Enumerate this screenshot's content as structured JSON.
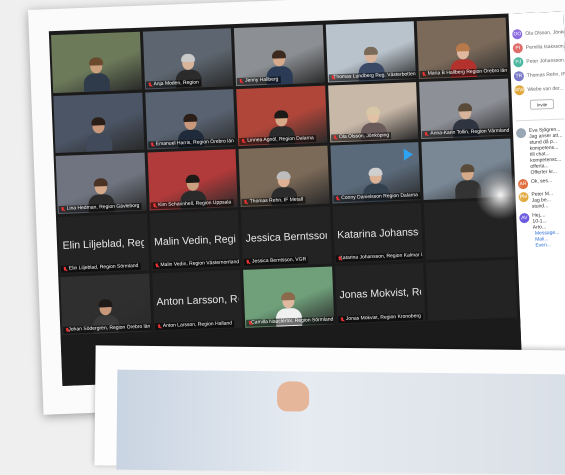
{
  "participants_grid": [
    {
      "name": "",
      "kind": "video",
      "bg": "#6c7a5a",
      "skin": "#caa07f",
      "hair": "#6b4a2e",
      "shirt": "#2f3b4a"
    },
    {
      "name": "Anja Moden, Region",
      "kind": "video",
      "bg": "#5d6670",
      "skin": "#d8b49a",
      "hair": "#c9c9c9",
      "shirt": "#2b2b2b"
    },
    {
      "name": "Jenny Hallberg",
      "kind": "video",
      "bg": "#8c8f93",
      "skin": "#d7a98b",
      "hair": "#3d2a1e",
      "shirt": "#2b3a55"
    },
    {
      "name": "Thomas Lundberg Reg. Västerbotten",
      "kind": "video",
      "bg": "#b9c3cc",
      "skin": "#d9b39a",
      "hair": "#7a6a5a",
      "shirt": "#3a4a66"
    },
    {
      "name": "Maria B Hallberg Region Örebro län",
      "kind": "video",
      "bg": "#7b6a5a",
      "skin": "#e0b8a0",
      "hair": "#b87a4a",
      "shirt": "#b3322e"
    },
    {
      "name": "",
      "kind": "video",
      "bg": "#4b5565",
      "skin": "#c9987a",
      "hair": "#2a1e16",
      "shirt": "#404a5a"
    },
    {
      "name": "Emanuel Harris, Region Örebro län",
      "kind": "video",
      "bg": "#586270",
      "skin": "#c9987a",
      "hair": "#2a1e16",
      "shirt": "#1f2a3a"
    },
    {
      "name": "Linnea Agnöl, Region Dalarna",
      "kind": "video",
      "bg": "#b0463a",
      "skin": "#d6a988",
      "hair": "#1e1a18",
      "shirt": "#2b2b2b"
    },
    {
      "name": "Ola Olsson, Jönköping",
      "kind": "video",
      "bg": "#c8b8a8",
      "skin": "#e2c0a6",
      "hair": "#d8c8a8",
      "shirt": "#6a5a5a"
    },
    {
      "name": "Anna-Karin Tollin, Region Värmland",
      "kind": "video",
      "bg": "#8e9097",
      "skin": "#d8b49a",
      "hair": "#5a4a3a",
      "shirt": "#2e3440"
    },
    {
      "name": "Lina Hedman, Region Gävleborg",
      "kind": "video",
      "bg": "#6f7480",
      "skin": "#d7a98b",
      "hair": "#4a3324",
      "shirt": "#2b2b2b"
    },
    {
      "name": "Kim Scharinhell, Region Uppsala",
      "kind": "video",
      "bg": "#b13a3a",
      "skin": "#caa07f",
      "hair": "#1e1a18",
      "shirt": "#2a2a2a"
    },
    {
      "name": "Thomas Rehn, IF Metall",
      "kind": "video",
      "bg": "#7c6a58",
      "skin": "#deb094",
      "hair": "#bdbdbd",
      "shirt": "#2b2b2b"
    },
    {
      "name": "Conny Danielsson Region Dalarna",
      "kind": "video",
      "bg": "#5b6a7a",
      "skin": "#dcb296",
      "hair": "#cfcfcf",
      "shirt": "#33404e"
    },
    {
      "name": "",
      "kind": "video",
      "bg": "#7a8896",
      "skin": "#d6a988",
      "hair": "#5a4a3a",
      "shirt": "#333"
    },
    {
      "name": "Elin Liljeblad, Region So...",
      "label": "Elin Liljeblad, Region Sörmland",
      "kind": "blank"
    },
    {
      "name": "Malin Vedin, Region Väs...",
      "label": "Malin Vedin, Region Västernorrland",
      "kind": "blank"
    },
    {
      "name": "Jessica Berntsson, VGR",
      "label": "Jessica Berntsson, VGR",
      "kind": "blank"
    },
    {
      "name": "Katarina Johansson, Re...",
      "label": "Katarina Johansson, Region Kalmar l...",
      "kind": "blank"
    },
    {
      "name": "",
      "kind": "blank"
    },
    {
      "name": "Johan Södergren, Region Örebro län",
      "kind": "video",
      "bg": "#2f2f2f",
      "skin": "#c9987a",
      "hair": "#1e1a18",
      "shirt": "#3a3a3a"
    },
    {
      "name": "Anton Larsson, Region...",
      "label": "Anton Larsson, Region Halland",
      "kind": "blank"
    },
    {
      "name": "Camilla Nauclértor, Region Sörmland",
      "kind": "video",
      "bg": "#6fa07a",
      "skin": "#e0b8a0",
      "hair": "#8a6a4a",
      "shirt": "#f0f0f0"
    },
    {
      "name": "Jonas Mokvist, Region...",
      "label": "Jonas Mokvist, Region Kronoberg",
      "kind": "blank"
    },
    {
      "name": "",
      "kind": "blank"
    }
  ],
  "sidebar": {
    "people": [
      {
        "initials": "OO",
        "name": "Ola Olsson, Jönkö...",
        "color": "#8b6be0"
      },
      {
        "initials": "PI",
        "name": "Pernilla Isaksson...",
        "color": "#e06b6b"
      },
      {
        "initials": "PJ",
        "name": "Peter Johansson...",
        "color": "#4cb8a0"
      },
      {
        "initials": "TR",
        "name": "Thomas Rehn, IF...",
        "color": "#7a7ac8"
      },
      {
        "initials": "WW",
        "name": "Wiebe van der...",
        "color": "#e0a83a"
      }
    ],
    "invite_label": "Invite",
    "chat": [
      {
        "initials": "",
        "lines": [
          "Eva Sjögren...",
          "Jag anser att...",
          "stund då p...",
          "kompetens...",
          "till chat...",
          "kompetensc...",
          "offerta...",
          "Offerter kr..."
        ]
      },
      {
        "initials": "AR",
        "color": "#e06b3a",
        "lines": [
          "Ok, ses..."
        ]
      },
      {
        "initials": "PM",
        "color": "#e0a83a",
        "lines": [
          "Peter M...",
          "Jag be...",
          "stund..."
        ]
      },
      {
        "initials": "AV",
        "color": "#6b5be0",
        "lines": [
          "Hej,...",
          "10-1...",
          "Arto..."
        ]
      }
    ],
    "chat_blue": [
      "Message...",
      "Mali...",
      "Even..."
    ]
  }
}
